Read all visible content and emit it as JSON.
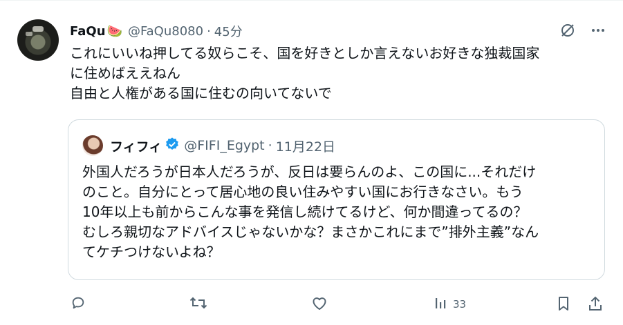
{
  "tweet": {
    "display_name": "FaQu",
    "name_emoji": "🍉",
    "handle": "@FaQu8080",
    "separator": "·",
    "time": "45分",
    "text_lines": [
      "これにいいね押してる奴らこそ、国を好きとしか言えないお好きな独裁国家",
      "に住めばええねん",
      "自由と人権がある国に住むの向いてないで"
    ]
  },
  "quote": {
    "display_name": "フィフィ",
    "handle": "@FIFI_Egypt",
    "separator": "·",
    "date": "11月22日",
    "text_lines": [
      "外国人だろうが日本人だろうが、反日は要らんのよ、この国に...それだけ",
      "のこと。自分にとって居心地の良い住みやすい国にお行きなさい。もう",
      "10年以上も前からこんな事を発信し続けてるけど、何か間違ってるの？",
      "むしろ親切なアドバイスじゃないかな？まさかこれにまで”排外主義”なん",
      "てケチつけないよね？"
    ]
  },
  "actions": {
    "views_count": "33"
  },
  "icons": {
    "grok": "grok-slash-icon",
    "more": "more-dots-icon",
    "reply": "reply-icon",
    "retweet": "retweet-icon",
    "like": "heart-icon",
    "views": "views-bar-icon",
    "bookmark": "bookmark-icon",
    "share": "share-icon",
    "verified": "verified-badge-icon"
  },
  "colors": {
    "text": "#0f1419",
    "muted": "#536471",
    "border": "#cfd9de",
    "verified": "#1d9bf0"
  }
}
